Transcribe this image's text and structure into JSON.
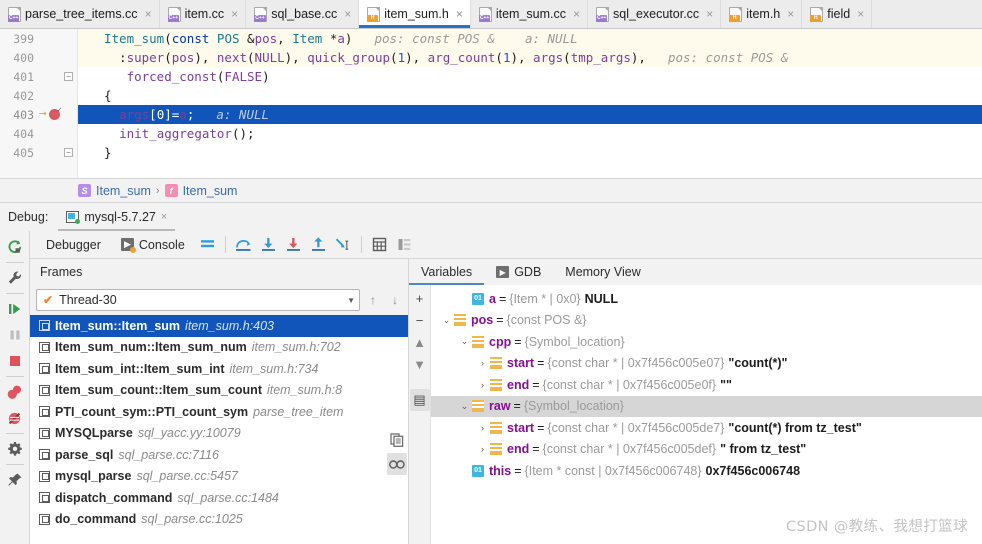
{
  "tabs": [
    {
      "label": "parse_tree_items.cc",
      "kind": "cpp",
      "active": false
    },
    {
      "label": "item.cc",
      "kind": "cpp",
      "active": false
    },
    {
      "label": "sql_base.cc",
      "kind": "cpp",
      "active": false
    },
    {
      "label": "item_sum.h",
      "kind": "h",
      "active": true
    },
    {
      "label": "item_sum.cc",
      "kind": "cpp",
      "active": false
    },
    {
      "label": "sql_executor.cc",
      "kind": "cpp",
      "active": false
    },
    {
      "label": "item.h",
      "kind": "h",
      "active": false
    },
    {
      "label": "field",
      "kind": "h",
      "active": false
    }
  ],
  "tab_close_glyph": "×",
  "editor": {
    "lines": [
      {
        "num": "399",
        "text": "Item_sum(const POS &pos, Item *a)",
        "hint": "pos: const POS &    a: NULL"
      },
      {
        "num": "400",
        "text": "  :super(pos), next(NULL), quick_group(1), arg_count(1), args(tmp_args),",
        "hint": "pos: const POS &"
      },
      {
        "num": "401",
        "text": "   forced_const(FALSE)",
        "hint": ""
      },
      {
        "num": "402",
        "text": "{",
        "hint": ""
      },
      {
        "num": "403",
        "text": "  args[0]=a;",
        "hint": "a: NULL"
      },
      {
        "num": "404",
        "text": "  init_aggregator();",
        "hint": ""
      },
      {
        "num": "405",
        "text": "}",
        "hint": ""
      }
    ],
    "current_line": "403",
    "execution_pointer_icon": "execution-arrow-icon",
    "breakpoint_icon": "breakpoint-verified-icon"
  },
  "breadcrumb": {
    "separator": "›",
    "items": [
      {
        "badge": "S",
        "label": "Item_sum"
      },
      {
        "badge": "f",
        "label": "Item_sum"
      }
    ]
  },
  "debug_header": {
    "label": "Debug:",
    "session": "mysql-5.7.27",
    "close_glyph": "×"
  },
  "debug_toolbar": {
    "tabs": [
      {
        "label": "Debugger",
        "icon": "debugger-tab-icon"
      },
      {
        "label": "Console",
        "icon": "console-icon"
      }
    ],
    "buttons": [
      {
        "name": "layout-settings-icon"
      },
      {
        "name": "step-over-icon"
      },
      {
        "name": "step-into-icon"
      },
      {
        "name": "force-step-into-icon"
      },
      {
        "name": "step-out-icon"
      },
      {
        "name": "run-to-cursor-icon"
      },
      {
        "name": "evaluate-expression-icon"
      },
      {
        "name": "show-variables-icon"
      }
    ]
  },
  "left_rail": [
    {
      "name": "rerun-icon"
    },
    {
      "name": "wrench-settings-icon"
    },
    {
      "name": "resume-program-icon"
    },
    {
      "name": "pause-program-icon"
    },
    {
      "name": "stop-program-icon"
    },
    {
      "name": "view-breakpoints-icon"
    },
    {
      "name": "mute-breakpoints-icon"
    },
    {
      "name": "settings-gear-icon"
    },
    {
      "name": "pin-tab-icon"
    }
  ],
  "frames": {
    "header": "Frames",
    "thread": "Thread-30",
    "thread_check_glyph": "✔",
    "dropdown_glyph": "▼",
    "up_glyph": "↑",
    "down_glyph": "↓",
    "rows": [
      {
        "fn": "Item_sum::Item_sum",
        "loc": "item_sum.h:403",
        "selected": true
      },
      {
        "fn": "Item_sum_num::Item_sum_num",
        "loc": "item_sum.h:702",
        "selected": false
      },
      {
        "fn": "Item_sum_int::Item_sum_int",
        "loc": "item_sum.h:734",
        "selected": false
      },
      {
        "fn": "Item_sum_count::Item_sum_count",
        "loc": "item_sum.h:8",
        "selected": false
      },
      {
        "fn": "PTI_count_sym::PTI_count_sym",
        "loc": "parse_tree_item",
        "selected": false
      },
      {
        "fn": "MYSQLparse",
        "loc": "sql_yacc.yy:10079",
        "selected": false
      },
      {
        "fn": "parse_sql",
        "loc": "sql_parse.cc:7116",
        "selected": false
      },
      {
        "fn": "mysql_parse",
        "loc": "sql_parse.cc:5457",
        "selected": false
      },
      {
        "fn": "dispatch_command",
        "loc": "sql_parse.cc:1484",
        "selected": false
      },
      {
        "fn": "do_command",
        "loc": "sql_parse.cc:1025",
        "selected": false
      }
    ],
    "side_buttons": [
      {
        "name": "copy-stack-icon",
        "active": false
      },
      {
        "name": "watches-icon",
        "active": true
      }
    ]
  },
  "variables": {
    "tabs": [
      {
        "label": "Variables",
        "selected": true
      },
      {
        "label": "GDB",
        "selected": false,
        "icon": "gdb-console-icon"
      },
      {
        "label": "Memory View",
        "selected": false
      }
    ],
    "toolbar": [
      {
        "name": "add-watch-icon",
        "glyph": "+"
      },
      {
        "name": "remove-watch-icon",
        "glyph": "−"
      },
      {
        "name": "move-watch-up-icon",
        "glyph": "▲"
      },
      {
        "name": "move-watch-down-icon",
        "glyph": "▼"
      },
      {
        "name": "inline-watches-icon",
        "glyph": "▤"
      }
    ],
    "rows": [
      {
        "indent": 1,
        "expander": "",
        "icon": "prim",
        "icon_label": "01",
        "name": "a",
        "type": "{Item * | 0x0}",
        "value": "NULL",
        "highlight": false
      },
      {
        "indent": 0,
        "expander": "⌄",
        "icon": "obj",
        "name": "pos",
        "type": "{const POS &}",
        "value": "",
        "highlight": false
      },
      {
        "indent": 1,
        "expander": "⌄",
        "icon": "obj",
        "name": "cpp",
        "type": "{Symbol_location}",
        "value": "",
        "highlight": false
      },
      {
        "indent": 2,
        "expander": "›",
        "icon": "obj",
        "name": "start",
        "type": "{const char * | 0x7f456c005e07}",
        "value": "\"count(*)\"",
        "highlight": false
      },
      {
        "indent": 2,
        "expander": "›",
        "icon": "obj",
        "name": "end",
        "type": "{const char * | 0x7f456c005e0f}",
        "value": "\"\"",
        "highlight": false
      },
      {
        "indent": 1,
        "expander": "⌄",
        "icon": "obj",
        "name": "raw",
        "type": "{Symbol_location}",
        "value": "",
        "highlight": true
      },
      {
        "indent": 2,
        "expander": "›",
        "icon": "obj",
        "name": "start",
        "type": "{const char * | 0x7f456c005de7}",
        "value": "\"count(*) from tz_test\"",
        "highlight": false
      },
      {
        "indent": 2,
        "expander": "›",
        "icon": "obj",
        "name": "end",
        "type": "{const char * | 0x7f456c005def}",
        "value": "\" from tz_test\"",
        "highlight": false
      },
      {
        "indent": 1,
        "expander": "",
        "icon": "prim",
        "icon_label": "01",
        "name": "this",
        "type": "{Item * const | 0x7f456c006748}",
        "value": "0x7f456c006748",
        "highlight": false
      }
    ]
  },
  "watermark": "CSDN @教练、我想打篮球"
}
